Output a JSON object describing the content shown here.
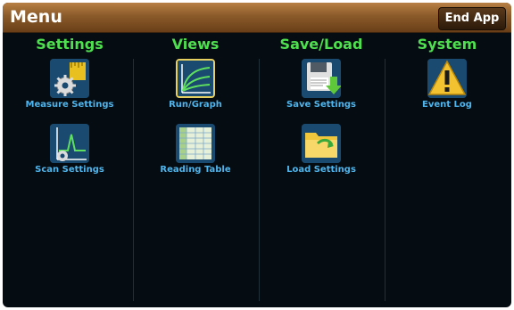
{
  "window": {
    "title": "Menu",
    "end_app_label": "End App"
  },
  "columns": [
    {
      "header": "Settings",
      "items": [
        {
          "label": "Measure Settings",
          "icon": "measure-settings-icon"
        },
        {
          "label": "Scan Settings",
          "icon": "scan-settings-icon"
        }
      ]
    },
    {
      "header": "Views",
      "items": [
        {
          "label": "Run/Graph",
          "icon": "graph-icon"
        },
        {
          "label": "Reading Table",
          "icon": "table-icon"
        }
      ]
    },
    {
      "header": "Save/Load",
      "items": [
        {
          "label": "Save Settings",
          "icon": "save-icon"
        },
        {
          "label": "Load Settings",
          "icon": "folder-icon"
        }
      ]
    },
    {
      "header": "System",
      "items": [
        {
          "label": "Event Log",
          "icon": "warning-icon"
        }
      ]
    }
  ],
  "colors": {
    "header": "#4ee04e",
    "label": "#4fb5ec",
    "titlebar": "#8a5a2a",
    "background": "#050c12"
  }
}
